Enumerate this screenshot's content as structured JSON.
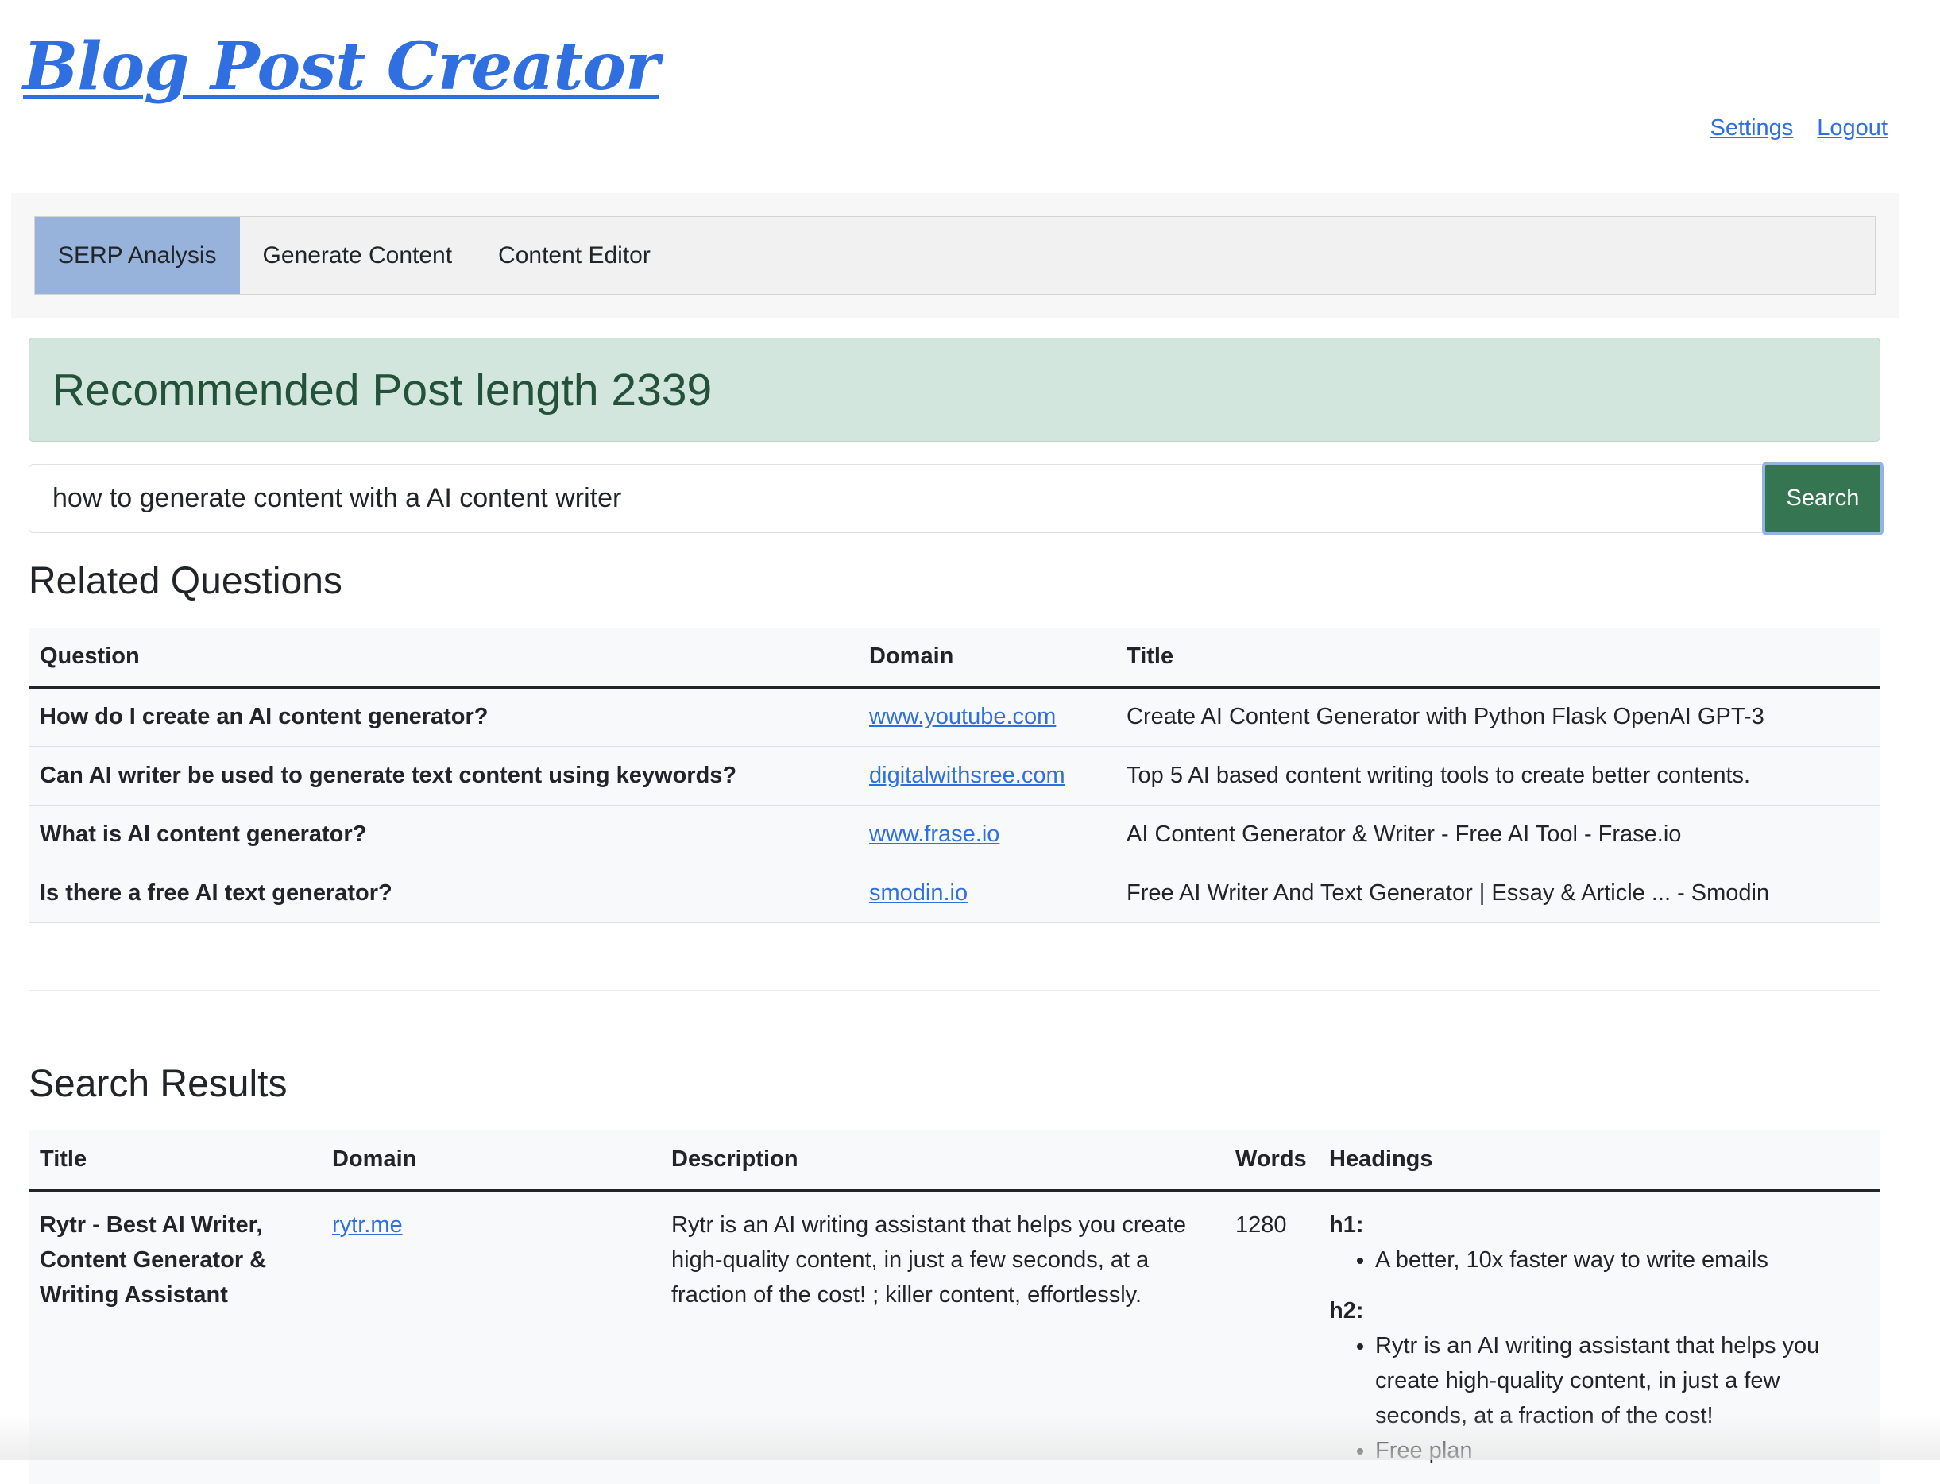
{
  "header": {
    "logo": "Blog Post Creator",
    "links": {
      "settings": "Settings",
      "logout": "Logout"
    }
  },
  "tabs": [
    {
      "label": "SERP Analysis",
      "active": true
    },
    {
      "label": "Generate Content",
      "active": false
    },
    {
      "label": "Content Editor",
      "active": false
    }
  ],
  "alert": {
    "text": "Recommended Post length 2339"
  },
  "search": {
    "value": "how to generate content with a AI content writer",
    "button": "Search"
  },
  "related": {
    "title": "Related Questions",
    "columns": [
      "Question",
      "Domain",
      "Title"
    ],
    "rows": [
      {
        "question": "How do I create an AI content generator?",
        "domain": "www.youtube.com",
        "title": "Create AI Content Generator with Python Flask OpenAI GPT-3"
      },
      {
        "question": "Can AI writer be used to generate text content using keywords?",
        "domain": "digitalwithsree.com",
        "title": "Top 5 AI based content writing tools to create better contents."
      },
      {
        "question": "What is AI content generator?",
        "domain": "www.frase.io",
        "title": "AI Content Generator & Writer - Free AI Tool - Frase.io"
      },
      {
        "question": "Is there a free AI text generator?",
        "domain": "smodin.io",
        "title": "Free AI Writer And Text Generator | Essay & Article ... - Smodin"
      }
    ]
  },
  "results": {
    "title": "Search Results",
    "columns": [
      "Title",
      "Domain",
      "Description",
      "Words",
      "Headings"
    ],
    "rows": [
      {
        "title": "Rytr - Best AI Writer, Content Generator & Writing Assistant",
        "domain": "rytr.me",
        "description": "Rytr is an AI writing assistant that helps you create high-quality content, in just a few seconds, at a fraction of the cost! ; killer content, effortlessly.",
        "words": "1280",
        "h1_label": "h1:",
        "h1": [
          "A better, 10x faster way to write emails"
        ],
        "h2_label": "h2:",
        "h2": [
          "Rytr is an AI writing assistant that helps you create high-quality content, in just a few seconds, at a fraction of the cost!",
          "Free plan"
        ]
      }
    ]
  },
  "colors": {
    "accent": "#2f6fe0",
    "tab_active": "#97b3dc",
    "alert_bg": "#d3e6dd",
    "alert_text": "#23513a",
    "search_btn": "#367552"
  }
}
